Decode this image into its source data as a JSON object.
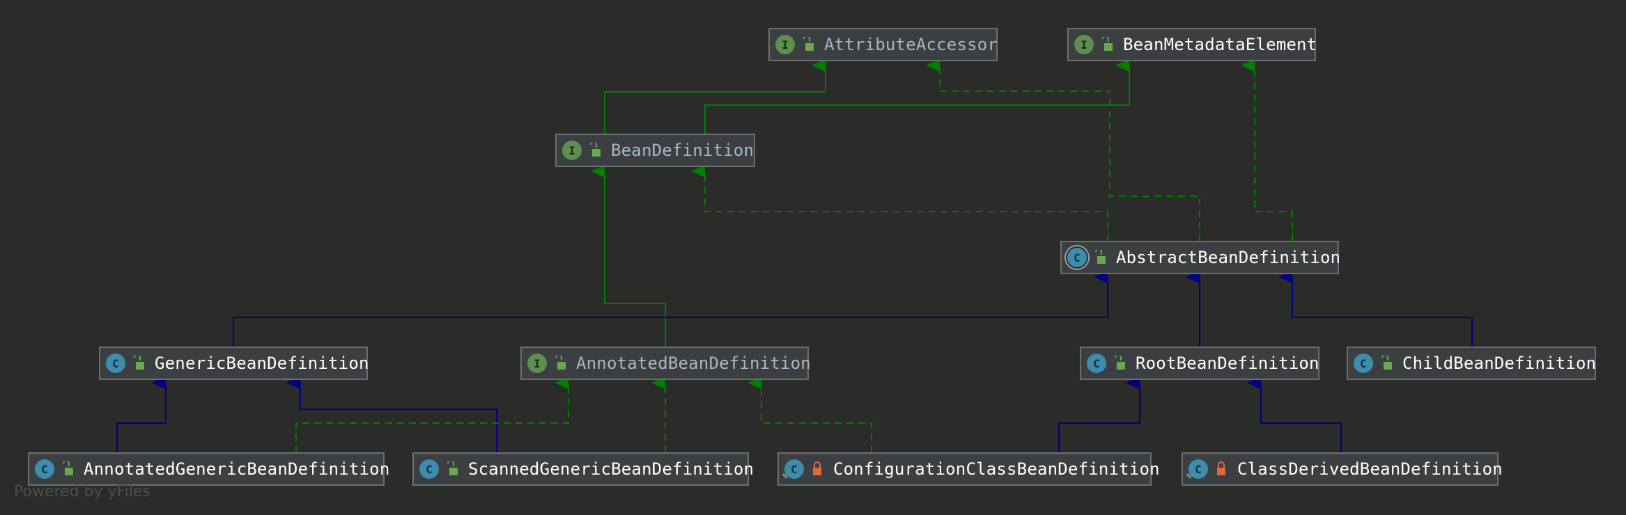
{
  "colors": {
    "background": "#2b2b29",
    "implements_edge": "#008000",
    "extends_edge": "#000080",
    "interface_badge": "#5e8f4e",
    "class_badge": "#3c8cad",
    "interface_label": "#a9b7c6",
    "class_label": "#ffffff",
    "public_lock": "#6aa84f",
    "private_lock": "#e0693c"
  },
  "legend_icons": {
    "interface": "interface-i-icon",
    "class": "class-c-icon",
    "abstract_class": "abstract-class-icon",
    "public": "unlocked-icon",
    "package_private": "locked-icon"
  },
  "nodes": {
    "attribute_accessor": {
      "label": "AttributeAccessor",
      "badge": "I",
      "kind": "interface",
      "access": "public"
    },
    "bean_metadata_element": {
      "label": "BeanMetadataElement",
      "badge": "I",
      "kind": "interface",
      "access": "public"
    },
    "bean_definition": {
      "label": "BeanDefinition",
      "badge": "I",
      "kind": "interface",
      "access": "public"
    },
    "abstract_bean_definition": {
      "label": "AbstractBeanDefinition",
      "badge": "C",
      "kind": "abstract-class",
      "access": "public"
    },
    "generic_bean_definition": {
      "label": "GenericBeanDefinition",
      "badge": "C",
      "kind": "class",
      "access": "public"
    },
    "annotated_bean_definition": {
      "label": "AnnotatedBeanDefinition",
      "badge": "I",
      "kind": "interface",
      "access": "public"
    },
    "root_bean_definition": {
      "label": "RootBeanDefinition",
      "badge": "C",
      "kind": "class",
      "access": "public"
    },
    "child_bean_definition": {
      "label": "ChildBeanDefinition",
      "badge": "C",
      "kind": "class",
      "access": "public"
    },
    "annotated_generic_bean_definition": {
      "label": "AnnotatedGenericBeanDefinition",
      "badge": "C",
      "kind": "class",
      "access": "public"
    },
    "scanned_generic_bean_definition": {
      "label": "ScannedGenericBeanDefinition",
      "badge": "C",
      "kind": "class",
      "access": "public"
    },
    "configuration_class_bean_definition": {
      "label": "ConfigurationClassBeanDefinition",
      "badge": "C",
      "kind": "final-class",
      "access": "package-private"
    },
    "class_derived_bean_definition": {
      "label": "ClassDerivedBeanDefinition",
      "badge": "C",
      "kind": "final-class",
      "access": "package-private"
    }
  },
  "edges": [
    {
      "from": "BeanDefinition",
      "to": "AttributeAccessor",
      "type": "extends-interface"
    },
    {
      "from": "BeanDefinition",
      "to": "BeanMetadataElement",
      "type": "extends-interface"
    },
    {
      "from": "AbstractBeanDefinition",
      "to": "BeanDefinition",
      "type": "implements"
    },
    {
      "from": "AbstractBeanDefinition",
      "to": "AttributeAccessor",
      "type": "implements"
    },
    {
      "from": "AbstractBeanDefinition",
      "to": "BeanMetadataElement",
      "type": "implements"
    },
    {
      "from": "GenericBeanDefinition",
      "to": "AbstractBeanDefinition",
      "type": "extends"
    },
    {
      "from": "RootBeanDefinition",
      "to": "AbstractBeanDefinition",
      "type": "extends"
    },
    {
      "from": "ChildBeanDefinition",
      "to": "AbstractBeanDefinition",
      "type": "extends"
    },
    {
      "from": "AnnotatedBeanDefinition",
      "to": "BeanDefinition",
      "type": "extends-interface"
    },
    {
      "from": "AnnotatedGenericBeanDefinition",
      "to": "GenericBeanDefinition",
      "type": "extends"
    },
    {
      "from": "ScannedGenericBeanDefinition",
      "to": "GenericBeanDefinition",
      "type": "extends"
    },
    {
      "from": "AnnotatedGenericBeanDefinition",
      "to": "AnnotatedBeanDefinition",
      "type": "implements"
    },
    {
      "from": "ScannedGenericBeanDefinition",
      "to": "AnnotatedBeanDefinition",
      "type": "implements"
    },
    {
      "from": "ConfigurationClassBeanDefinition",
      "to": "AnnotatedBeanDefinition",
      "type": "implements"
    },
    {
      "from": "ConfigurationClassBeanDefinition",
      "to": "RootBeanDefinition",
      "type": "extends"
    },
    {
      "from": "ClassDerivedBeanDefinition",
      "to": "RootBeanDefinition",
      "type": "extends"
    }
  ],
  "watermark": "Powered by yFiles"
}
